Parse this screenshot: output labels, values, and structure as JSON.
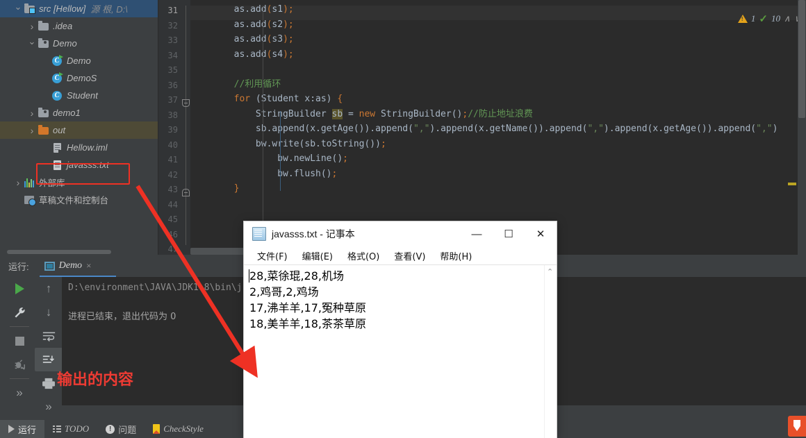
{
  "project_tree": {
    "items": [
      {
        "label": "src [Hellow]",
        "suffix": "源 根, D:\\",
        "icon": "source-folder-icon",
        "depth": 0,
        "state": "expanded",
        "selected": true
      },
      {
        "label": ".idea",
        "suffix": "",
        "icon": "folder-icon",
        "depth": 1,
        "state": "collapsed",
        "selected": false
      },
      {
        "label": "Demo",
        "suffix": "",
        "icon": "package-folder-icon",
        "depth": 1,
        "state": "expanded",
        "selected": false
      },
      {
        "label": "Demo",
        "suffix": "",
        "icon": "java-class-runnable-icon",
        "depth": 2,
        "state": "leaf",
        "selected": false
      },
      {
        "label": "DemoS",
        "suffix": "",
        "icon": "java-class-runnable-icon",
        "depth": 2,
        "state": "leaf",
        "selected": false
      },
      {
        "label": "Student",
        "suffix": "",
        "icon": "java-class-icon",
        "depth": 2,
        "state": "leaf",
        "selected": false
      },
      {
        "label": "demo1",
        "suffix": "",
        "icon": "package-folder-icon",
        "depth": 1,
        "state": "collapsed",
        "selected": false
      },
      {
        "label": "out",
        "suffix": "",
        "icon": "excluded-folder-icon",
        "depth": 1,
        "state": "collapsed",
        "selected": false
      },
      {
        "label": "Hellow.iml",
        "suffix": "",
        "icon": "iml-file-icon",
        "depth": 2,
        "state": "leaf",
        "selected": false
      },
      {
        "label": "javasss.txt",
        "suffix": "",
        "icon": "text-file-icon",
        "depth": 2,
        "state": "leaf",
        "selected": false
      },
      {
        "label": "外部库",
        "suffix": "",
        "icon": "external-libraries-icon",
        "depth": 0,
        "state": "collapsed",
        "selected": false
      },
      {
        "label": "草稿文件和控制台",
        "suffix": "",
        "icon": "scratches-console-icon",
        "depth": 0,
        "state": "leaf",
        "selected": false
      }
    ]
  },
  "editor": {
    "first_line": 31,
    "line_numbers": [
      31,
      32,
      33,
      34,
      35,
      36,
      37,
      38,
      39,
      40,
      41,
      42,
      43,
      44,
      45,
      46,
      47
    ],
    "lines": [
      {
        "n": 31,
        "tokens": [
          {
            "t": "        ",
            "c": "pln"
          },
          {
            "t": "as",
            "c": "id"
          },
          {
            "t": ".",
            "c": "pln"
          },
          {
            "t": "add",
            "c": "meth"
          },
          {
            "t": "(",
            "c": "sem"
          },
          {
            "t": "s1",
            "c": "id"
          },
          {
            "t": ")",
            "c": "sem"
          },
          {
            "t": ";",
            "c": "sem"
          }
        ]
      },
      {
        "n": 32,
        "tokens": [
          {
            "t": "        ",
            "c": "pln"
          },
          {
            "t": "as",
            "c": "id"
          },
          {
            "t": ".",
            "c": "pln"
          },
          {
            "t": "add",
            "c": "meth"
          },
          {
            "t": "(",
            "c": "sem"
          },
          {
            "t": "s2",
            "c": "id"
          },
          {
            "t": ")",
            "c": "sem"
          },
          {
            "t": ";",
            "c": "sem"
          }
        ]
      },
      {
        "n": 33,
        "tokens": [
          {
            "t": "        ",
            "c": "pln"
          },
          {
            "t": "as",
            "c": "id"
          },
          {
            "t": ".",
            "c": "pln"
          },
          {
            "t": "add",
            "c": "meth"
          },
          {
            "t": "(",
            "c": "sem"
          },
          {
            "t": "s3",
            "c": "id"
          },
          {
            "t": ")",
            "c": "sem"
          },
          {
            "t": ";",
            "c": "sem"
          }
        ]
      },
      {
        "n": 34,
        "tokens": [
          {
            "t": "        ",
            "c": "pln"
          },
          {
            "t": "as",
            "c": "id"
          },
          {
            "t": ".",
            "c": "pln"
          },
          {
            "t": "add",
            "c": "meth"
          },
          {
            "t": "(",
            "c": "sem"
          },
          {
            "t": "s4",
            "c": "id"
          },
          {
            "t": ")",
            "c": "sem"
          },
          {
            "t": ";",
            "c": "sem"
          }
        ]
      },
      {
        "n": 35,
        "tokens": []
      },
      {
        "n": 36,
        "tokens": [
          {
            "t": "        ",
            "c": "pln"
          },
          {
            "t": "//利用循环",
            "c": "cmt"
          }
        ]
      },
      {
        "n": 37,
        "tokens": [
          {
            "t": "        ",
            "c": "pln"
          },
          {
            "t": "for",
            "c": "kw"
          },
          {
            "t": " (Student x:as) ",
            "c": "pln"
          },
          {
            "t": "{",
            "c": "sem"
          }
        ]
      },
      {
        "n": 38,
        "tokens": [
          {
            "t": "            StringBuilder ",
            "c": "pln"
          },
          {
            "t": "sb",
            "c": "hl"
          },
          {
            "t": " = ",
            "c": "pln"
          },
          {
            "t": "new",
            "c": "kw"
          },
          {
            "t": " StringBuilder()",
            "c": "pln"
          },
          {
            "t": ";",
            "c": "sem"
          },
          {
            "t": "//防止地址浪费",
            "c": "cmt"
          }
        ]
      },
      {
        "n": 39,
        "tokens": [
          {
            "t": "            sb.",
            "c": "pln"
          },
          {
            "t": "append",
            "c": "meth"
          },
          {
            "t": "(x.",
            "c": "pln"
          },
          {
            "t": "getAge",
            "c": "meth"
          },
          {
            "t": "()).",
            "c": "pln"
          },
          {
            "t": "append",
            "c": "meth"
          },
          {
            "t": "(",
            "c": "pln"
          },
          {
            "t": "\",\"",
            "c": "str"
          },
          {
            "t": ").",
            "c": "pln"
          },
          {
            "t": "append",
            "c": "meth"
          },
          {
            "t": "(x.",
            "c": "pln"
          },
          {
            "t": "getName",
            "c": "meth"
          },
          {
            "t": "()).",
            "c": "pln"
          },
          {
            "t": "append",
            "c": "meth"
          },
          {
            "t": "(",
            "c": "pln"
          },
          {
            "t": "\",\"",
            "c": "str"
          },
          {
            "t": ").",
            "c": "pln"
          },
          {
            "t": "append",
            "c": "meth"
          },
          {
            "t": "(x.",
            "c": "pln"
          },
          {
            "t": "getAge",
            "c": "meth"
          },
          {
            "t": "()).",
            "c": "pln"
          },
          {
            "t": "append",
            "c": "meth"
          },
          {
            "t": "(",
            "c": "pln"
          },
          {
            "t": "\",\"",
            "c": "str"
          },
          {
            "t": ")",
            "c": "pln"
          }
        ]
      },
      {
        "n": 40,
        "tokens": [
          {
            "t": "            bw.",
            "c": "pln"
          },
          {
            "t": "write",
            "c": "meth"
          },
          {
            "t": "(sb.",
            "c": "pln"
          },
          {
            "t": "toString",
            "c": "meth"
          },
          {
            "t": "())",
            "c": "pln"
          },
          {
            "t": ";",
            "c": "sem"
          }
        ]
      },
      {
        "n": 41,
        "tokens": [
          {
            "t": "                bw.",
            "c": "pln"
          },
          {
            "t": "newLine",
            "c": "meth"
          },
          {
            "t": "()",
            "c": "pln"
          },
          {
            "t": ";",
            "c": "sem"
          }
        ]
      },
      {
        "n": 42,
        "tokens": [
          {
            "t": "                bw.",
            "c": "pln"
          },
          {
            "t": "flush",
            "c": "meth"
          },
          {
            "t": "()",
            "c": "pln"
          },
          {
            "t": ";",
            "c": "sem"
          }
        ]
      },
      {
        "n": 43,
        "tokens": [
          {
            "t": "        ",
            "c": "pln"
          },
          {
            "t": "}",
            "c": "sem"
          }
        ]
      },
      {
        "n": 44,
        "tokens": []
      },
      {
        "n": 45,
        "tokens": []
      },
      {
        "n": 46,
        "tokens": []
      },
      {
        "n": 47,
        "tokens": []
      }
    ],
    "inspections": {
      "warning_count": "1",
      "ok_count": "10",
      "up_chevron": "∧",
      "down_chevron": "∨"
    }
  },
  "run_panel": {
    "title": "运行:",
    "tab_label": "Demo",
    "tab_close": "×",
    "console_lines": [
      {
        "text": "D:\\environment\\JAVA\\JDK1.8\\bin\\j",
        "cjk": false
      },
      {
        "text": "进程已结束，退出代码为 0",
        "cjk": true
      }
    ],
    "toolbar_left": [
      "run-icon",
      "settings-wrench-icon",
      "stop-icon",
      "debug-icon",
      "more-icon"
    ],
    "toolbar_right": [
      "up-arrow-icon",
      "down-arrow-icon",
      "soft-wrap-icon",
      "scroll-to-end-icon",
      "print-icon",
      "more-icon"
    ],
    "more_label": "»"
  },
  "status_bar": {
    "items": [
      {
        "label": "运行",
        "icon": "run-triangle-icon",
        "active": true
      },
      {
        "label": "TODO",
        "icon": "todo-list-icon",
        "active": false
      },
      {
        "label": "问题",
        "icon": "problems-icon",
        "active": false
      },
      {
        "label": "CheckStyle",
        "icon": "checkstyle-icon",
        "active": false
      }
    ]
  },
  "notepad": {
    "title": "javasss.txt - 记事本",
    "icon": "notepad-icon",
    "window_buttons": {
      "minimize": "—",
      "maximize": "☐",
      "close": "✕"
    },
    "menu": [
      "文件(F)",
      "编辑(E)",
      "格式(O)",
      "查看(V)",
      "帮助(H)"
    ],
    "content_lines": [
      "28,菜徐琨,28,机场",
      "2,鸡哥,2,鸡场",
      "17,沸羊羊,17,冤种草原",
      "18,美羊羊,18,茶茶草原"
    ],
    "scroll_up_arrow": "⌃"
  },
  "annotations": {
    "note_text": "输出的内容",
    "highlight_color": "#ee3124",
    "arrow_color": "#ee3124"
  }
}
